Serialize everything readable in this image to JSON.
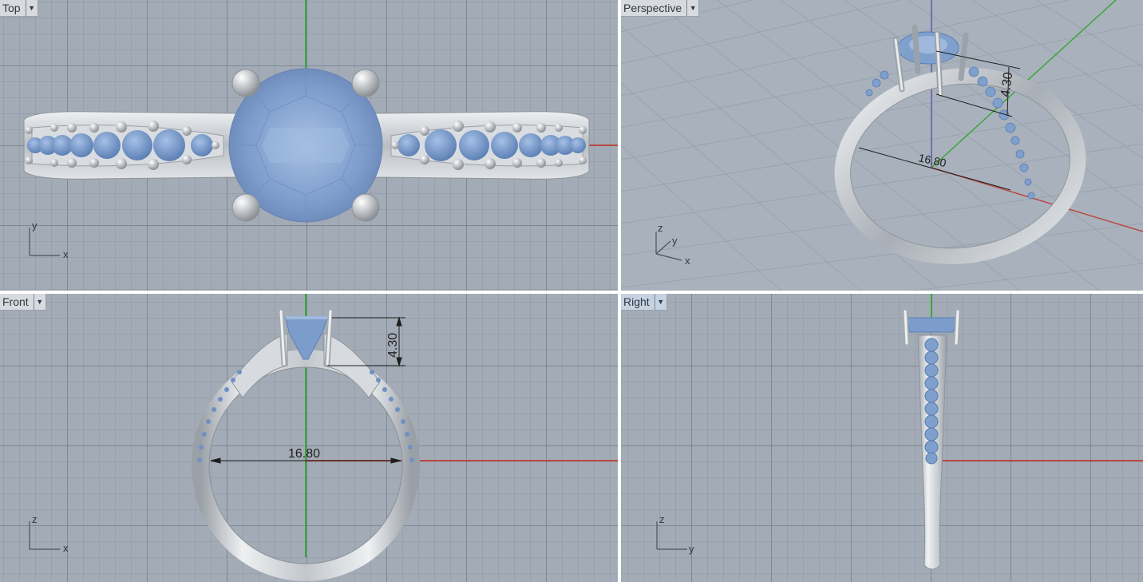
{
  "viewports": {
    "top": {
      "label": "Top",
      "axis_h": "x",
      "axis_v": "y"
    },
    "perspective": {
      "label": "Perspective",
      "axis_z": "z",
      "axis_y": "y",
      "axis_x": "x",
      "dim_height": "4.30",
      "dim_width": "16.80"
    },
    "front": {
      "label": "Front",
      "axis_h": "x",
      "axis_v": "z",
      "dim_height": "4.30",
      "dim_width": "16.80"
    },
    "right": {
      "label": "Right",
      "axis_h": "y",
      "axis_v": "z"
    }
  },
  "colors": {
    "viewport_bg": "#a3acb6",
    "x_axis": "#b84a42",
    "y_axis": "#3aa53a",
    "z_axis": "#5a5aa8",
    "metal": "#c9cdd2",
    "gem": "#7fa0cc",
    "active_tab": "#c4d2e2"
  },
  "icons": {
    "dropdown": "dropdown-arrow-icon"
  }
}
